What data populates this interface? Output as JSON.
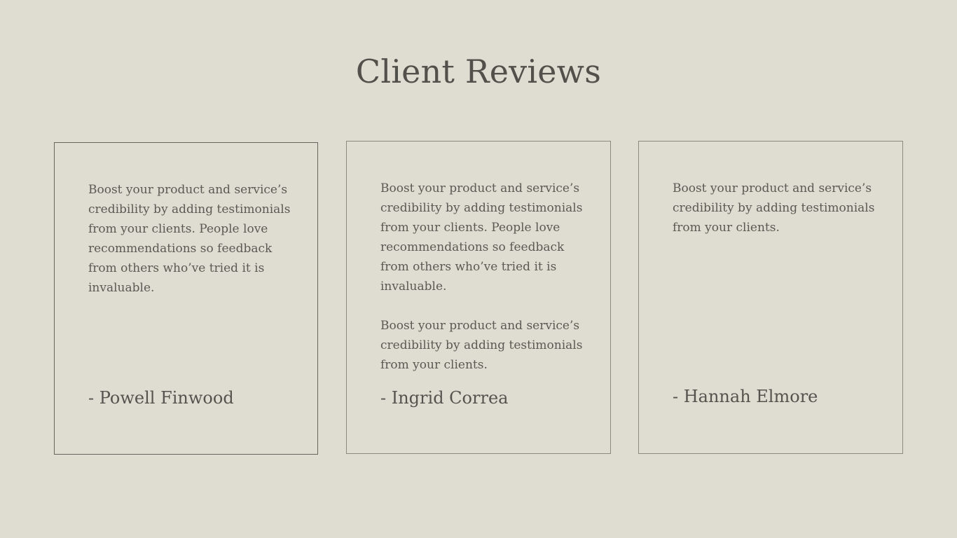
{
  "page": {
    "title": "Client Reviews"
  },
  "reviews": [
    {
      "paragraphs": [
        "Boost your product and service’s credibility by adding testimonials from your clients. People love recommendations so feedback from others who’ve tried it is invaluable."
      ],
      "author": "- Powell Finwood"
    },
    {
      "paragraphs": [
        "Boost your product and service’s credibility by adding testimonials from your clients. People love recommendations so feedback from others who’ve tried it is invaluable.",
        "Boost your product and service’s credibility by adding testimonials from your clients."
      ],
      "author": "- Ingrid Correa"
    },
    {
      "paragraphs": [
        "Boost your product and service’s credibility by adding testimonials from your clients."
      ],
      "author": "- Hannah Elmore"
    }
  ],
  "colors": {
    "background": "#dfddd2",
    "text": "#54524d",
    "border": "#8b8880"
  }
}
